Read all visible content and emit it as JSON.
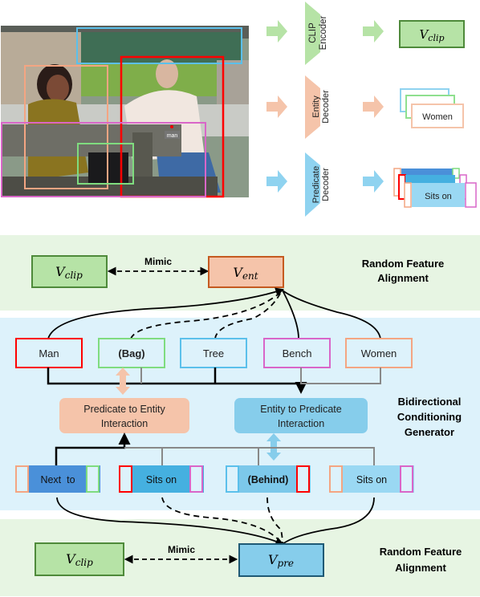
{
  "top": {
    "photo": {
      "description": "Photo of a woman and a man sitting at a wooden bench near a river",
      "tag_label": "man",
      "boxes": [
        {
          "name": "tree",
          "color": "#5bc0eb"
        },
        {
          "name": "man",
          "color": "#ff0000"
        },
        {
          "name": "women",
          "color": "#f4a582"
        },
        {
          "name": "bench",
          "color": "#d966c8"
        },
        {
          "name": "bag",
          "color": "#7fdc7f"
        }
      ]
    },
    "clip_encoder": {
      "line1": "CLIP",
      "line2": "Encoder",
      "color": "#b6e3a6"
    },
    "entity_decoder": {
      "line1": "Entity",
      "line2": "Decoder",
      "color": "#f5c4aa"
    },
    "predicate_decoder": {
      "line1": "Predicate",
      "line2": "Decoder",
      "color": "#8fd3f0"
    },
    "v_clip": {
      "base": "V",
      "sub": "clip"
    },
    "entity_card_label": "Women",
    "predicate_card_label": "Sits on"
  },
  "ent_alignment": {
    "v_clip": {
      "base": "V",
      "sub": "clip"
    },
    "v_ent": {
      "base": "V",
      "sub": "ent"
    },
    "mimic": "Mimic",
    "title_line1": "Random Feature",
    "title_line2": "Alignment"
  },
  "generator": {
    "entities": [
      {
        "label": "Man",
        "color": "#ff0000",
        "bold": false
      },
      {
        "label": "(Bag)",
        "color": "#7fdc7f",
        "bold": true
      },
      {
        "label": "Tree",
        "color": "#5bc0eb",
        "bold": false
      },
      {
        "label": "Bench",
        "color": "#d966c8",
        "bold": false
      },
      {
        "label": "Women",
        "color": "#f4a582",
        "bold": false
      }
    ],
    "p2e": {
      "line1": "Predicate to Entity",
      "line2": "Interaction"
    },
    "e2p": {
      "line1": "Entity to Predicate",
      "line2": "Interaction"
    },
    "title_line1": "Bidirectional",
    "title_line2": "Conditioning",
    "title_line3": "Generator",
    "predicates": [
      {
        "label": "Next  to",
        "fill": "#4a90d9",
        "left": "#f4a582",
        "right": "#7fdc7f",
        "bold": false
      },
      {
        "label": "Sits on",
        "fill": "#45b0e0",
        "left": "#ff0000",
        "right": "#d966c8",
        "bold": false
      },
      {
        "label": "(Behind)",
        "fill": "#7cc8ea",
        "left": "#5bc0eb",
        "right": "#ff0000",
        "bold": true
      },
      {
        "label": "Sits on",
        "fill": "#9ad8f3",
        "left": "#f4a582",
        "right": "#d966c8",
        "bold": false
      }
    ]
  },
  "pre_alignment": {
    "v_clip": {
      "base": "V",
      "sub": "clip"
    },
    "v_pre": {
      "base": "V",
      "sub": "pre"
    },
    "mimic": "Mimic",
    "title_line1": "Random Feature",
    "title_line2": "Alignment"
  }
}
